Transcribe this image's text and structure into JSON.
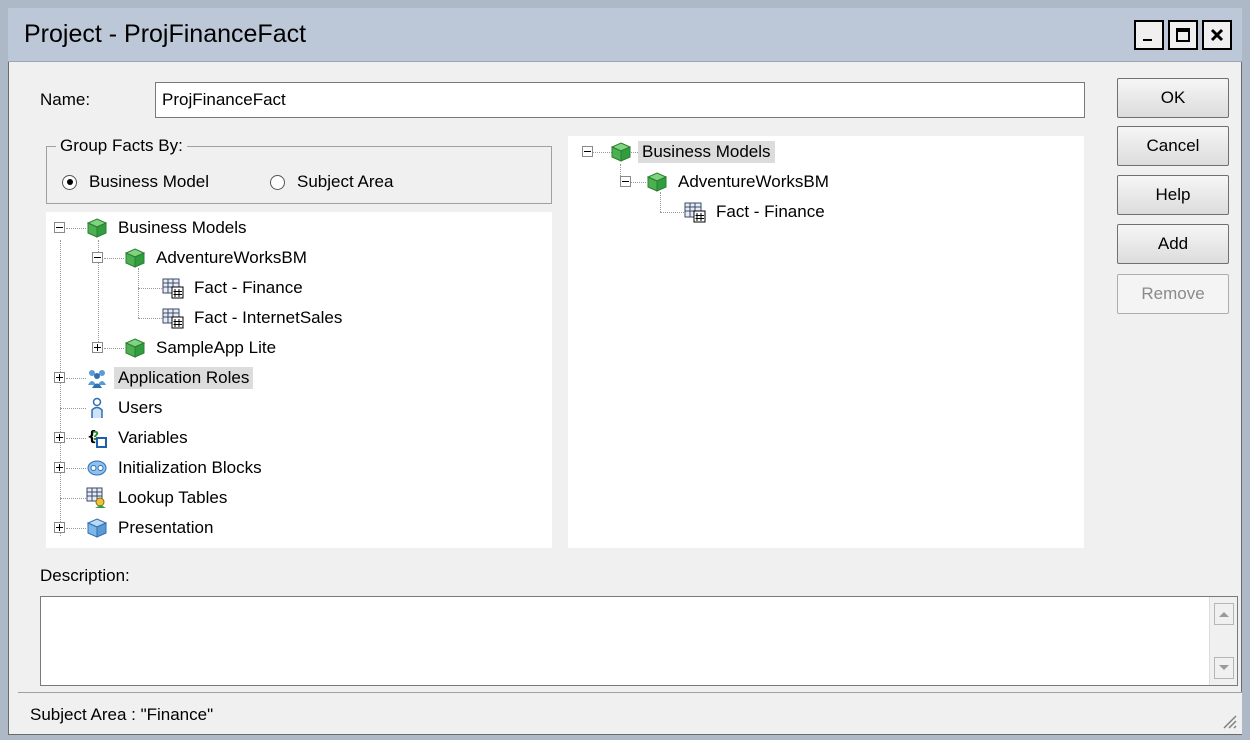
{
  "window": {
    "title": "Project - ProjFinanceFact"
  },
  "titlebar_buttons": {
    "minimize": "_",
    "maximize": "□",
    "close": "✕"
  },
  "name": {
    "label": "Name:",
    "value": "ProjFinanceFact"
  },
  "buttons": {
    "ok": "OK",
    "cancel": "Cancel",
    "help": "Help",
    "add": "Add",
    "remove": "Remove"
  },
  "group_facts": {
    "legend": "Group Facts By:",
    "options": [
      {
        "label": "Business Model",
        "selected": true
      },
      {
        "label": "Subject Area",
        "selected": false
      }
    ]
  },
  "left_tree": {
    "nodes": [
      {
        "label": "Business Models",
        "icon": "business-model-icon"
      },
      {
        "label": "AdventureWorksBM",
        "icon": "business-model-icon"
      },
      {
        "label": "Fact - Finance",
        "icon": "fact-table-icon"
      },
      {
        "label": "Fact - InternetSales",
        "icon": "fact-table-icon"
      },
      {
        "label": "SampleApp Lite",
        "icon": "business-model-icon"
      },
      {
        "label": "Application Roles",
        "icon": "roles-icon",
        "highlighted": true
      },
      {
        "label": "Users",
        "icon": "user-icon"
      },
      {
        "label": "Variables",
        "icon": "variables-icon"
      },
      {
        "label": "Initialization Blocks",
        "icon": "init-blocks-icon"
      },
      {
        "label": "Lookup Tables",
        "icon": "lookup-tables-icon"
      },
      {
        "label": "Presentation",
        "icon": "presentation-icon"
      }
    ]
  },
  "right_tree": {
    "nodes": [
      {
        "label": "Business Models",
        "icon": "business-model-icon",
        "highlighted": true
      },
      {
        "label": "AdventureWorksBM",
        "icon": "business-model-icon"
      },
      {
        "label": "Fact - Finance",
        "icon": "fact-table-icon"
      }
    ]
  },
  "description": {
    "label": "Description:",
    "value": ""
  },
  "status": {
    "text": "Subject Area : \"Finance\""
  }
}
